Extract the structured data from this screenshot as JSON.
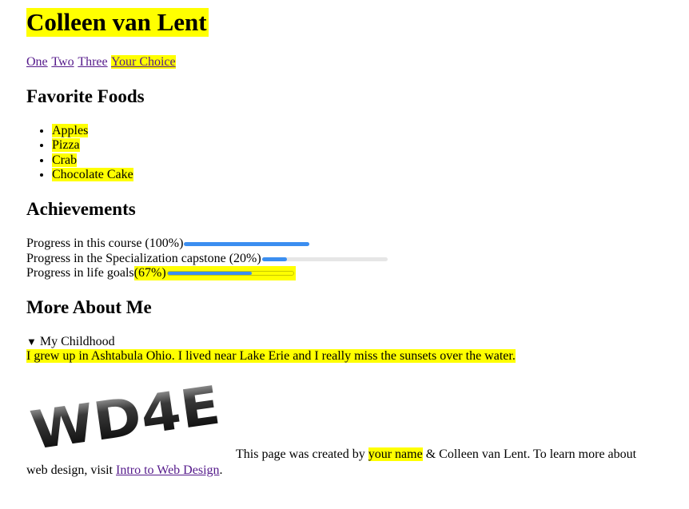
{
  "header": {
    "title": "Colleen van Lent"
  },
  "nav": {
    "links": [
      "One",
      "Two",
      "Three",
      "Your Choice"
    ]
  },
  "foods": {
    "heading": "Favorite Foods",
    "items": [
      "Apples",
      "Pizza",
      "Crab",
      "Chocolate Cake"
    ]
  },
  "achievements": {
    "heading": "Achievements",
    "items": [
      {
        "label": "Progress in this course (100%)",
        "value": 1.0
      },
      {
        "label": "Progress in the Specialization capstone (20%)",
        "value": 0.2
      },
      {
        "label_prefix": "Progress in life goals ",
        "label_pct": "(67%)",
        "value": 0.67
      }
    ]
  },
  "more": {
    "heading": "More About Me",
    "summary": "My Childhood",
    "body": "I grew up in Ashtabula Ohio. I lived near Lake Erie and I really miss the sunsets over the water."
  },
  "logo": {
    "text": "WD4E"
  },
  "footer": {
    "part1": "This page was created by ",
    "name_placeholder": "your name",
    "part2": " & Colleen van Lent. To learn more about web design, visit ",
    "link": "Intro to Web Design",
    "end": "."
  },
  "colors": {
    "highlight": "#ffff00",
    "progress_fill": "#3b8ef0",
    "link_visited": "#551a8b"
  }
}
